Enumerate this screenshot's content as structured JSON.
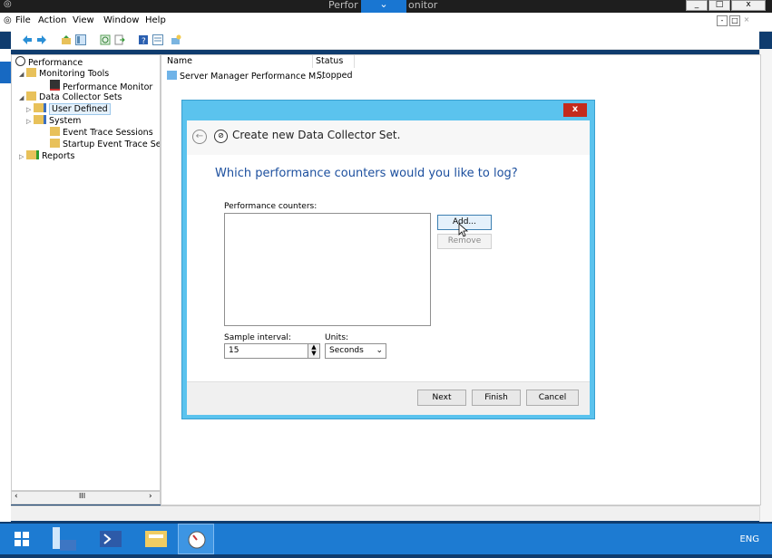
{
  "outer_window": {
    "title_left": "Perfor",
    "title_right": "onitor",
    "icon": "perfmon-icon",
    "controls": [
      "_",
      "□",
      "x"
    ]
  },
  "menubar": {
    "items": [
      "File",
      "Action",
      "View",
      "Window",
      "Help"
    ],
    "mdi_controls": [
      "-",
      "□",
      "×"
    ]
  },
  "toolbar": {
    "icons": [
      "back-arrow-icon",
      "forward-arrow-icon",
      "up-folder-icon",
      "show-hide-tree-icon",
      "refresh-icon",
      "export-icon",
      "help-icon",
      "properties-icon",
      "new-icon"
    ]
  },
  "tree": {
    "items": [
      {
        "label": "Performance",
        "level": 0
      },
      {
        "label": "Monitoring Tools",
        "level": 1
      },
      {
        "label": "Performance Monitor",
        "level": 2
      },
      {
        "label": "Data Collector Sets",
        "level": 1
      },
      {
        "label": "User Defined",
        "level": 2
      },
      {
        "label": "System",
        "level": 2
      },
      {
        "label": "Event Trace Sessions",
        "level": 2
      },
      {
        "label": "Startup Event Trace Ses",
        "level": 2
      },
      {
        "label": "Reports",
        "level": 1
      }
    ],
    "scroll_thumb": "III"
  },
  "list": {
    "col_name": "Name",
    "col_status": "Status",
    "rows": [
      {
        "name": "Server Manager Performance M...",
        "status": "Stopped"
      }
    ]
  },
  "dialog": {
    "title": "Create new Data Collector Set.",
    "close": "x",
    "question": "Which performance counters would you like to log?",
    "counters_label": "Performance counters:",
    "add_label": "Add...",
    "remove_label": "Remove",
    "sample_label": "Sample interval:",
    "sample_value": "15",
    "units_label": "Units:",
    "units_value": "Seconds",
    "next_label": "Next",
    "finish_label": "Finish",
    "cancel_label": "Cancel"
  },
  "taskbar": {
    "items": [
      "windows-start-icon",
      "server-manager-icon",
      "powershell-icon",
      "file-explorer-icon",
      "perfmon-icon"
    ],
    "language": "ENG"
  },
  "colors": {
    "dialog_frame": "#5bc3ee",
    "taskbar": "#1d7bd2",
    "question_text": "#1c4f9e",
    "close_red": "#c42b1c"
  }
}
